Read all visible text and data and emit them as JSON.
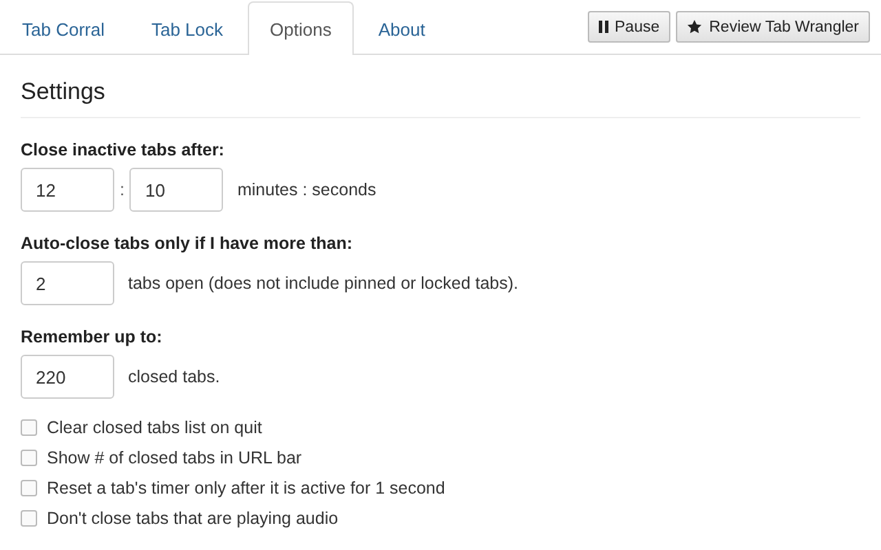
{
  "tabs": [
    {
      "label": "Tab Corral",
      "selected": false
    },
    {
      "label": "Tab Lock",
      "selected": false
    },
    {
      "label": "Options",
      "selected": true
    },
    {
      "label": "About",
      "selected": false
    }
  ],
  "toolbar_buttons": [
    {
      "kind": "pause",
      "label": "Pause"
    },
    {
      "kind": "star",
      "label": "Review Tab Wrangler"
    }
  ],
  "heading": "Settings",
  "close_after": {
    "label": "Close inactive tabs after:",
    "minutes": "12",
    "separator": ":",
    "seconds": "10",
    "unit": "minutes : seconds"
  },
  "min_tabs": {
    "label": "Auto-close tabs only if I have more than:",
    "value": "2",
    "suffix": "tabs open (does not include pinned or locked tabs)."
  },
  "remember": {
    "label": "Remember up to:",
    "value": "220",
    "suffix": "closed tabs."
  },
  "options": [
    {
      "label": "Clear closed tabs list on quit",
      "checked": false
    },
    {
      "label": "Show # of closed tabs in URL bar",
      "checked": false
    },
    {
      "label": "Reset a tab's timer only after it is active for 1 second",
      "checked": false
    },
    {
      "label": "Don't close tabs that are playing audio",
      "checked": false
    }
  ]
}
